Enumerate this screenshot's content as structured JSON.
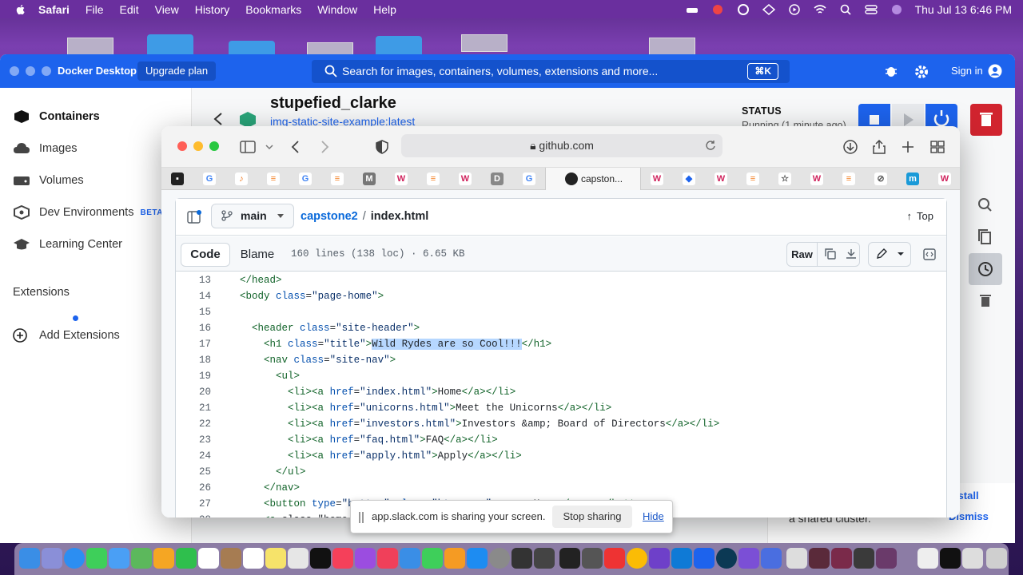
{
  "menubar": {
    "app": "Safari",
    "items": [
      "File",
      "Edit",
      "View",
      "History",
      "Bookmarks",
      "Window",
      "Help"
    ],
    "clock": "Thu Jul 13  6:46 PM"
  },
  "docker": {
    "app_name": "Docker Desktop",
    "upgrade": "Upgrade plan",
    "search_placeholder": "Search for images, containers, volumes, extensions and more...",
    "search_shortcut": "⌘K",
    "sign_in": "Sign in",
    "sidebar": {
      "items": [
        {
          "label": "Containers",
          "active": true
        },
        {
          "label": "Images"
        },
        {
          "label": "Volumes"
        },
        {
          "label": "Dev Environments",
          "badge": "BETA"
        },
        {
          "label": "Learning Center"
        }
      ],
      "extensions": "Extensions",
      "add_extensions": "Add Extensions"
    },
    "container": {
      "name": "stupefied_clarke",
      "image": "img-static-site-example:latest",
      "status_label": "STATUS",
      "status_value": "Running (1 minute ago)"
    },
    "promo": {
      "text": "extension and connect to a shared cluster.",
      "install": "Install",
      "dismiss": "Dismiss"
    }
  },
  "safari": {
    "url": "github.com",
    "active_tab": "capston...",
    "github": {
      "branch": "main",
      "repo": "capstone2",
      "separator": "/",
      "file": "index.html",
      "top": "Top",
      "tab_code": "Code",
      "tab_blame": "Blame",
      "meta": "160 lines (138 loc) · 6.65 KB",
      "raw": "Raw",
      "lines": [
        {
          "n": "13",
          "indent": "",
          "html": "</head>"
        },
        {
          "n": "14",
          "indent": "",
          "html": "<body class=\"page-home\">"
        },
        {
          "n": "15",
          "indent": "",
          "html": ""
        },
        {
          "n": "16",
          "indent": "  ",
          "html": "<header class=\"site-header\">"
        },
        {
          "n": "17",
          "indent": "    ",
          "html": "<h1 class=\"title\">Wild Rydes are so Cool!!!</h1>",
          "highlight": "Wild Rydes are so Cool!!!"
        },
        {
          "n": "18",
          "indent": "    ",
          "html": "<nav class=\"site-nav\">"
        },
        {
          "n": "19",
          "indent": "      ",
          "html": "<ul>"
        },
        {
          "n": "20",
          "indent": "        ",
          "html": "<li><a href=\"index.html\">Home</a></li>"
        },
        {
          "n": "21",
          "indent": "        ",
          "html": "<li><a href=\"unicorns.html\">Meet the Unicorns</a></li>"
        },
        {
          "n": "22",
          "indent": "        ",
          "html": "<li><a href=\"investors.html\">Investors &amp; Board of Directors</a></li>"
        },
        {
          "n": "23",
          "indent": "        ",
          "html": "<li><a href=\"faq.html\">FAQ</a></li>"
        },
        {
          "n": "24",
          "indent": "        ",
          "html": "<li><a href=\"apply.html\">Apply</a></li>"
        },
        {
          "n": "25",
          "indent": "      ",
          "html": "</ul>"
        },
        {
          "n": "26",
          "indent": "    ",
          "html": "</nav>"
        },
        {
          "n": "27",
          "indent": "    ",
          "html": "<button type=\"button\" class=\"btn-menu\"><span>Menu</span></button>"
        },
        {
          "n": "28",
          "indent": "    ",
          "html": "<a class=\"home-"
        }
      ]
    }
  },
  "share_banner": {
    "text": "app.slack.com is sharing your screen.",
    "stop": "Stop sharing",
    "hide": "Hide"
  },
  "colors": {
    "docker_blue": "#1d63ed",
    "github_link": "#0969da",
    "danger": "#d1242f",
    "selection": "#b6d7ff"
  }
}
